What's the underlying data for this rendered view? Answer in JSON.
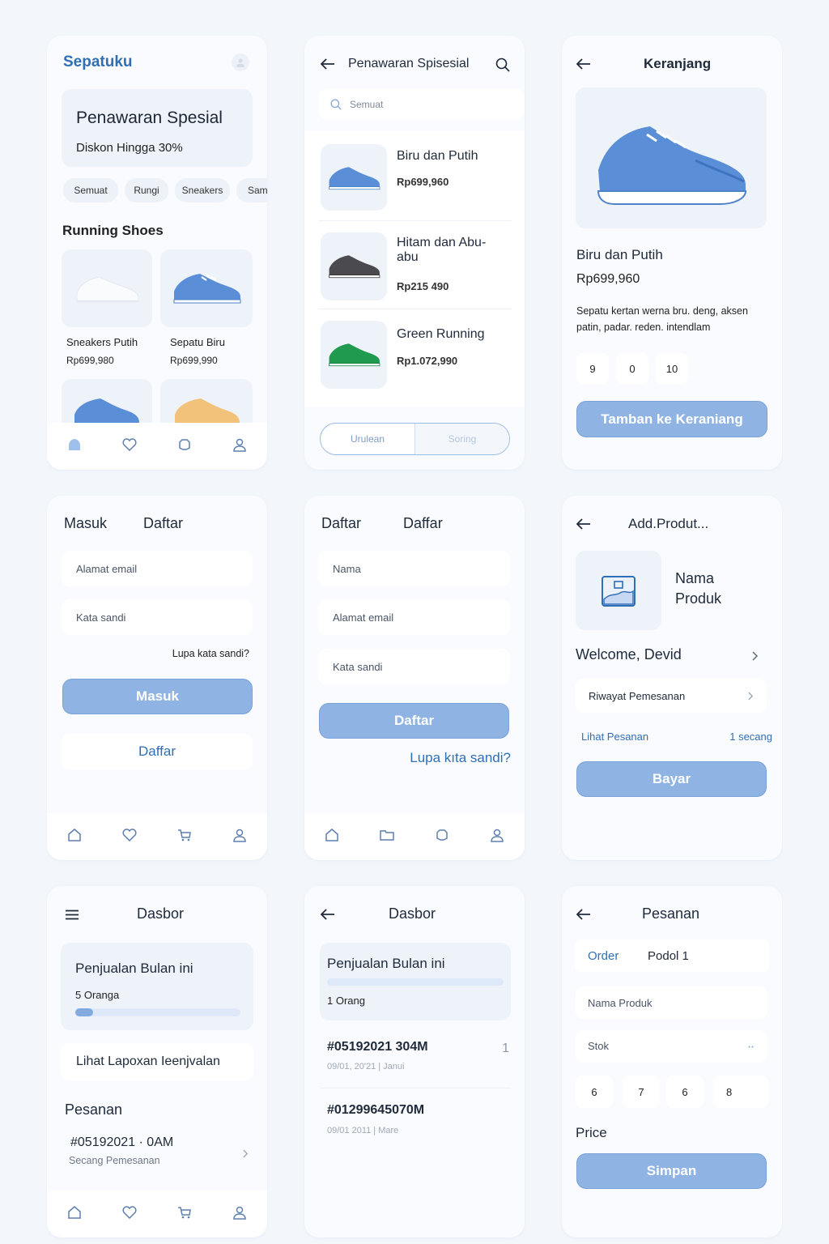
{
  "colors": {
    "accent": "#2f6fb6",
    "button": "#8fb3e3",
    "background": "#f3f7fc"
  },
  "s1": {
    "brand": "Sepatuku",
    "promo_title": "Penawaran Spesial",
    "promo_sub": "Diskon Hingga 30%",
    "chips": [
      "Semuat",
      "Rungi",
      "Sneakers",
      "Sam"
    ],
    "section_title": "Running Shoes",
    "products": [
      {
        "name": "Sneakers Putih",
        "price": "Rp699,980"
      },
      {
        "name": "Sepatu Biru",
        "price": "Rp699,990"
      }
    ],
    "nav": [
      "home-icon",
      "heart-icon",
      "bag-icon",
      "profile-icon"
    ]
  },
  "s2": {
    "title": "Penawaran Spisesial",
    "search_placeholder": "Semuat",
    "items": [
      {
        "name": "Biru dan Putih",
        "price": "Rp699,960",
        "color": "#5a8fd8"
      },
      {
        "name": "Hitam dan Abu-abu",
        "price": "Rp215 490",
        "color": "#4a4a4f"
      },
      {
        "name": "Green Running",
        "price": "Rp1.072,990",
        "color": "#1f9a4e"
      }
    ],
    "seg_left": "Urulean",
    "seg_right": "Soring"
  },
  "s3": {
    "title": "Keranjang",
    "name": "Biru dan Putih",
    "price": "Rp699,960",
    "desc": "Sepatu kertan werna bru. deng, aksen patin, padar. reden. intendlam",
    "sizes": [
      "9",
      "0",
      "10"
    ],
    "cta": "Tamban ke Keraniang"
  },
  "s4": {
    "tab_login": "Masuk",
    "tab_register": "Daftar",
    "email": "Alamat email",
    "password": "Kata sandi",
    "forgot": "Lupa kata sandi?",
    "login_btn": "Masuk",
    "register_link": "Daffar"
  },
  "s5": {
    "tab1": "Daftar",
    "tab2": "Daffar",
    "name": "Nama",
    "email": "Alamat email",
    "password": "Kata sandi",
    "btn": "Daftar",
    "forgot": "Lupa kıta sandi?"
  },
  "s6": {
    "title": "Add.Produt...",
    "product_name": "Nama Produk",
    "welcome": "Welcome, Devid",
    "history": "Riwayat Pemesanan",
    "link": "Lihat Pesanan",
    "time": "1 secang",
    "btn": "Bayar"
  },
  "s7": {
    "title": "Dasbor",
    "sales_title": "Penjualan Bulan ini",
    "sales_count": "5 Oranga",
    "sales_progress": 0.11,
    "report": "Lihat Lapoxan Ieenjvalan",
    "orders_title": "Pesanan",
    "order_id": "#05192021 · 0AM",
    "order_sub": "Secang Pemesanan"
  },
  "s8": {
    "title": "Dasbor",
    "sales_title": "Penjualan Bulan ini",
    "sales_count": "1 Orang",
    "orders": [
      {
        "id": "#05192021 304M",
        "meta": "09/01, 20'21 | Janui",
        "count": "1"
      },
      {
        "id": "#01299645070M",
        "meta": "09/01 2011 | Mare",
        "count": ""
      }
    ]
  },
  "s9": {
    "title": "Pesanan",
    "tab1": "Order",
    "tab2": "Podol 1",
    "product_field": "Nama Produk",
    "stock_field": "Stok",
    "stock_values": [
      "6",
      "7",
      "6",
      "8"
    ],
    "price_label": "Price",
    "btn": "Simpan"
  }
}
